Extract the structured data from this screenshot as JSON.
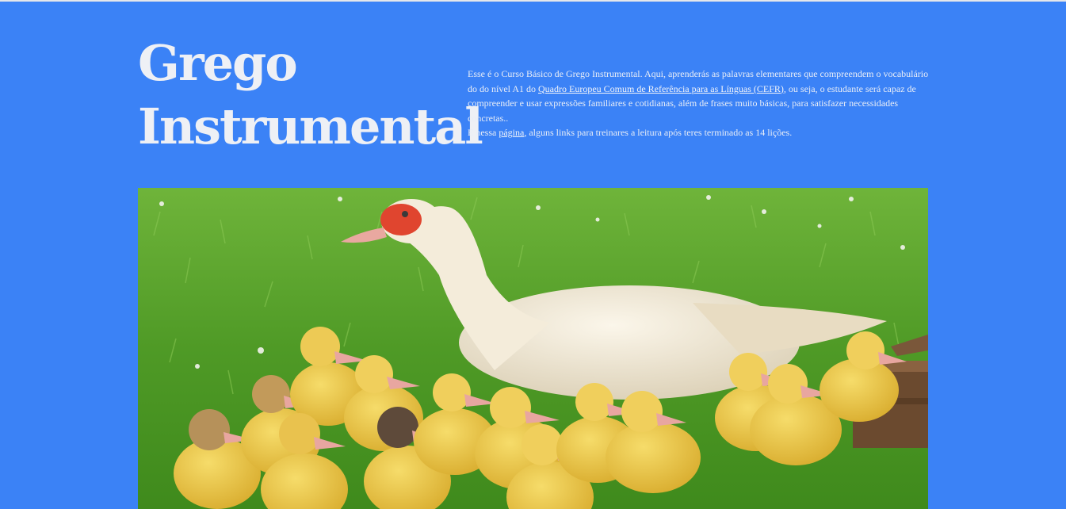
{
  "header": {
    "title_line1": "Grego",
    "title_line2": "Instrumental"
  },
  "intro": {
    "p1_start": "Esse é o Curso Básico de Grego Instrumental. Aqui, aprenderás as palavras elementares que compreendem o vocabulário do do nível A1 do ",
    "cefr_link": "Quadro Europeu Comum de Referência para as Línguas (CEFR)",
    "p1_end": ", ou seja, o estudante será capaz de compreender e usar expressões familiares e cotidianas, além de frases muito básicas, para satisfazer necessidades concretas..",
    "p2_start": "E nessa ",
    "pagina_link": "página",
    "p2_end": ", alguns links para treinares a leitura após teres terminado as 14 lições."
  },
  "colors": {
    "background": "#3b82f6",
    "title": "#eef0f5",
    "text": "#e8edf7"
  }
}
